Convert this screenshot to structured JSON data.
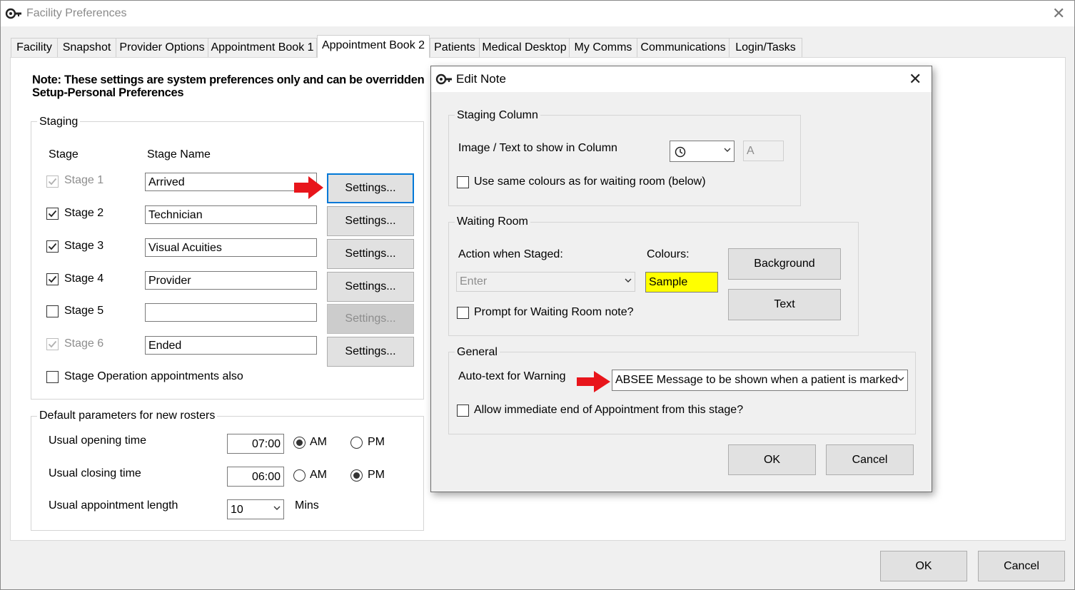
{
  "window": {
    "title": "Facility Preferences"
  },
  "tabs": [
    "Facility",
    "Snapshot",
    "Provider Options",
    "Appointment Book 1",
    "Appointment Book 2",
    "Patients",
    "Medical Desktop",
    "My Comms",
    "Communications",
    "Login/Tasks"
  ],
  "active_tab": "Appointment Book 2",
  "note": {
    "line1": "Note: These settings are system preferences only and can be overridden",
    "line2": "Setup-Personal Preferences"
  },
  "staging": {
    "group_label": "Staging",
    "col_stage": "Stage",
    "col_stage_name": "Stage Name",
    "rows": [
      {
        "label": "Stage 1",
        "name": "Arrived",
        "checked": true,
        "check_disabled": true,
        "settings": "Settings...",
        "settings_disabled": false
      },
      {
        "label": "Stage 2",
        "name": "Technician",
        "checked": true,
        "check_disabled": false,
        "settings": "Settings...",
        "settings_disabled": false
      },
      {
        "label": "Stage 3",
        "name": "Visual Acuities",
        "checked": true,
        "check_disabled": false,
        "settings": "Settings...",
        "settings_disabled": false
      },
      {
        "label": "Stage 4",
        "name": "Provider",
        "checked": true,
        "check_disabled": false,
        "settings": "Settings...",
        "settings_disabled": false
      },
      {
        "label": "Stage 5",
        "name": "",
        "checked": false,
        "check_disabled": false,
        "settings": "Settings...",
        "settings_disabled": true
      },
      {
        "label": "Stage 6",
        "name": "Ended",
        "checked": true,
        "check_disabled": true,
        "settings": "Settings...",
        "settings_disabled": false
      }
    ],
    "operation_label": "Stage Operation appointments also"
  },
  "defaults": {
    "group_label": "Default parameters for new rosters",
    "opening_label": "Usual opening time",
    "opening_value": "07:00",
    "closing_label": "Usual closing time",
    "closing_value": "06:00",
    "am": "AM",
    "pm": "PM",
    "length_label": "Usual appointment length",
    "length_value": "10",
    "mins": "Mins"
  },
  "footer": {
    "ok": "OK",
    "cancel": "Cancel"
  },
  "edit_note": {
    "title": "Edit Note",
    "staging_column": {
      "group_label": "Staging Column",
      "image_label": "Image / Text to show in Column",
      "image_text_value": "A",
      "same_colours_label": "Use same colours as for waiting room (below)"
    },
    "waiting_room": {
      "group_label": "Waiting Room",
      "action_label": "Action when Staged:",
      "action_value": "Enter",
      "colours_label": "Colours:",
      "sample": "Sample",
      "sample_color": "#ffff00",
      "background_btn": "Background",
      "text_btn": "Text",
      "prompt_label": "Prompt for Waiting Room note?"
    },
    "general": {
      "group_label": "General",
      "autotext_label": "Auto-text for Warning",
      "autotext_value": "ABSEE Message to be shown when a patient is marked",
      "allow_end_label": "Allow immediate end of Appointment from this stage?"
    },
    "ok": "OK",
    "cancel": "Cancel"
  },
  "colors": {
    "accent_border": "#0078d7",
    "arrow": "#e8151b"
  }
}
